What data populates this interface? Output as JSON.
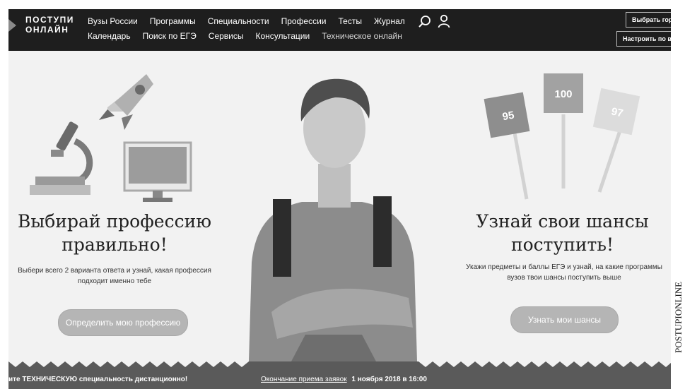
{
  "header": {
    "logo_line1": "ПОСТУПИ",
    "logo_line2": "ОНЛАЙН",
    "nav_primary": [
      "Вузы России",
      "Программы",
      "Специальности",
      "Профессии",
      "Тесты",
      "Журнал"
    ],
    "nav_secondary": [
      "Календарь",
      "Поиск по ЕГЭ",
      "Сервисы",
      "Консультации",
      "Техническое онлайн"
    ],
    "city_button": "Выбрать город",
    "tune_button": "Настроить по вузу",
    "icons": [
      "search-icon",
      "user-icon"
    ]
  },
  "hero": {
    "left": {
      "title_line1": "Выбирай профессию",
      "title_line2": "правильно!",
      "text_line1": "Выбери всего 2 варианта ответа и узнай, какая профессия",
      "text_line2": "подходит именно тебе",
      "button": "Определить мою профессию"
    },
    "right": {
      "title_line1": "Узнай свои шансы",
      "title_line2": "поступить!",
      "text_line1": "Укажи предметы и баллы ЕГЭ и узнай, на какие программы",
      "text_line2": "вузов твои шансы поступить выше",
      "button": "Узнать мои шансы",
      "scores": [
        "95",
        "100",
        "97"
      ]
    }
  },
  "strip": {
    "left_text": "ите ТЕХНИЧЕСКУЮ специальность дистанционно!",
    "deadline_label": "Окончание приема заявок",
    "deadline_date": "1 ноября 2018 в 16:00"
  },
  "side_caption": "POSTUPIONLINE",
  "colors": {
    "header_bg": "#1e1e1e",
    "hero_bg": "#f2f2f2",
    "button_bg": "#b5b5b5",
    "strip_bg": "#5a5a5a"
  }
}
